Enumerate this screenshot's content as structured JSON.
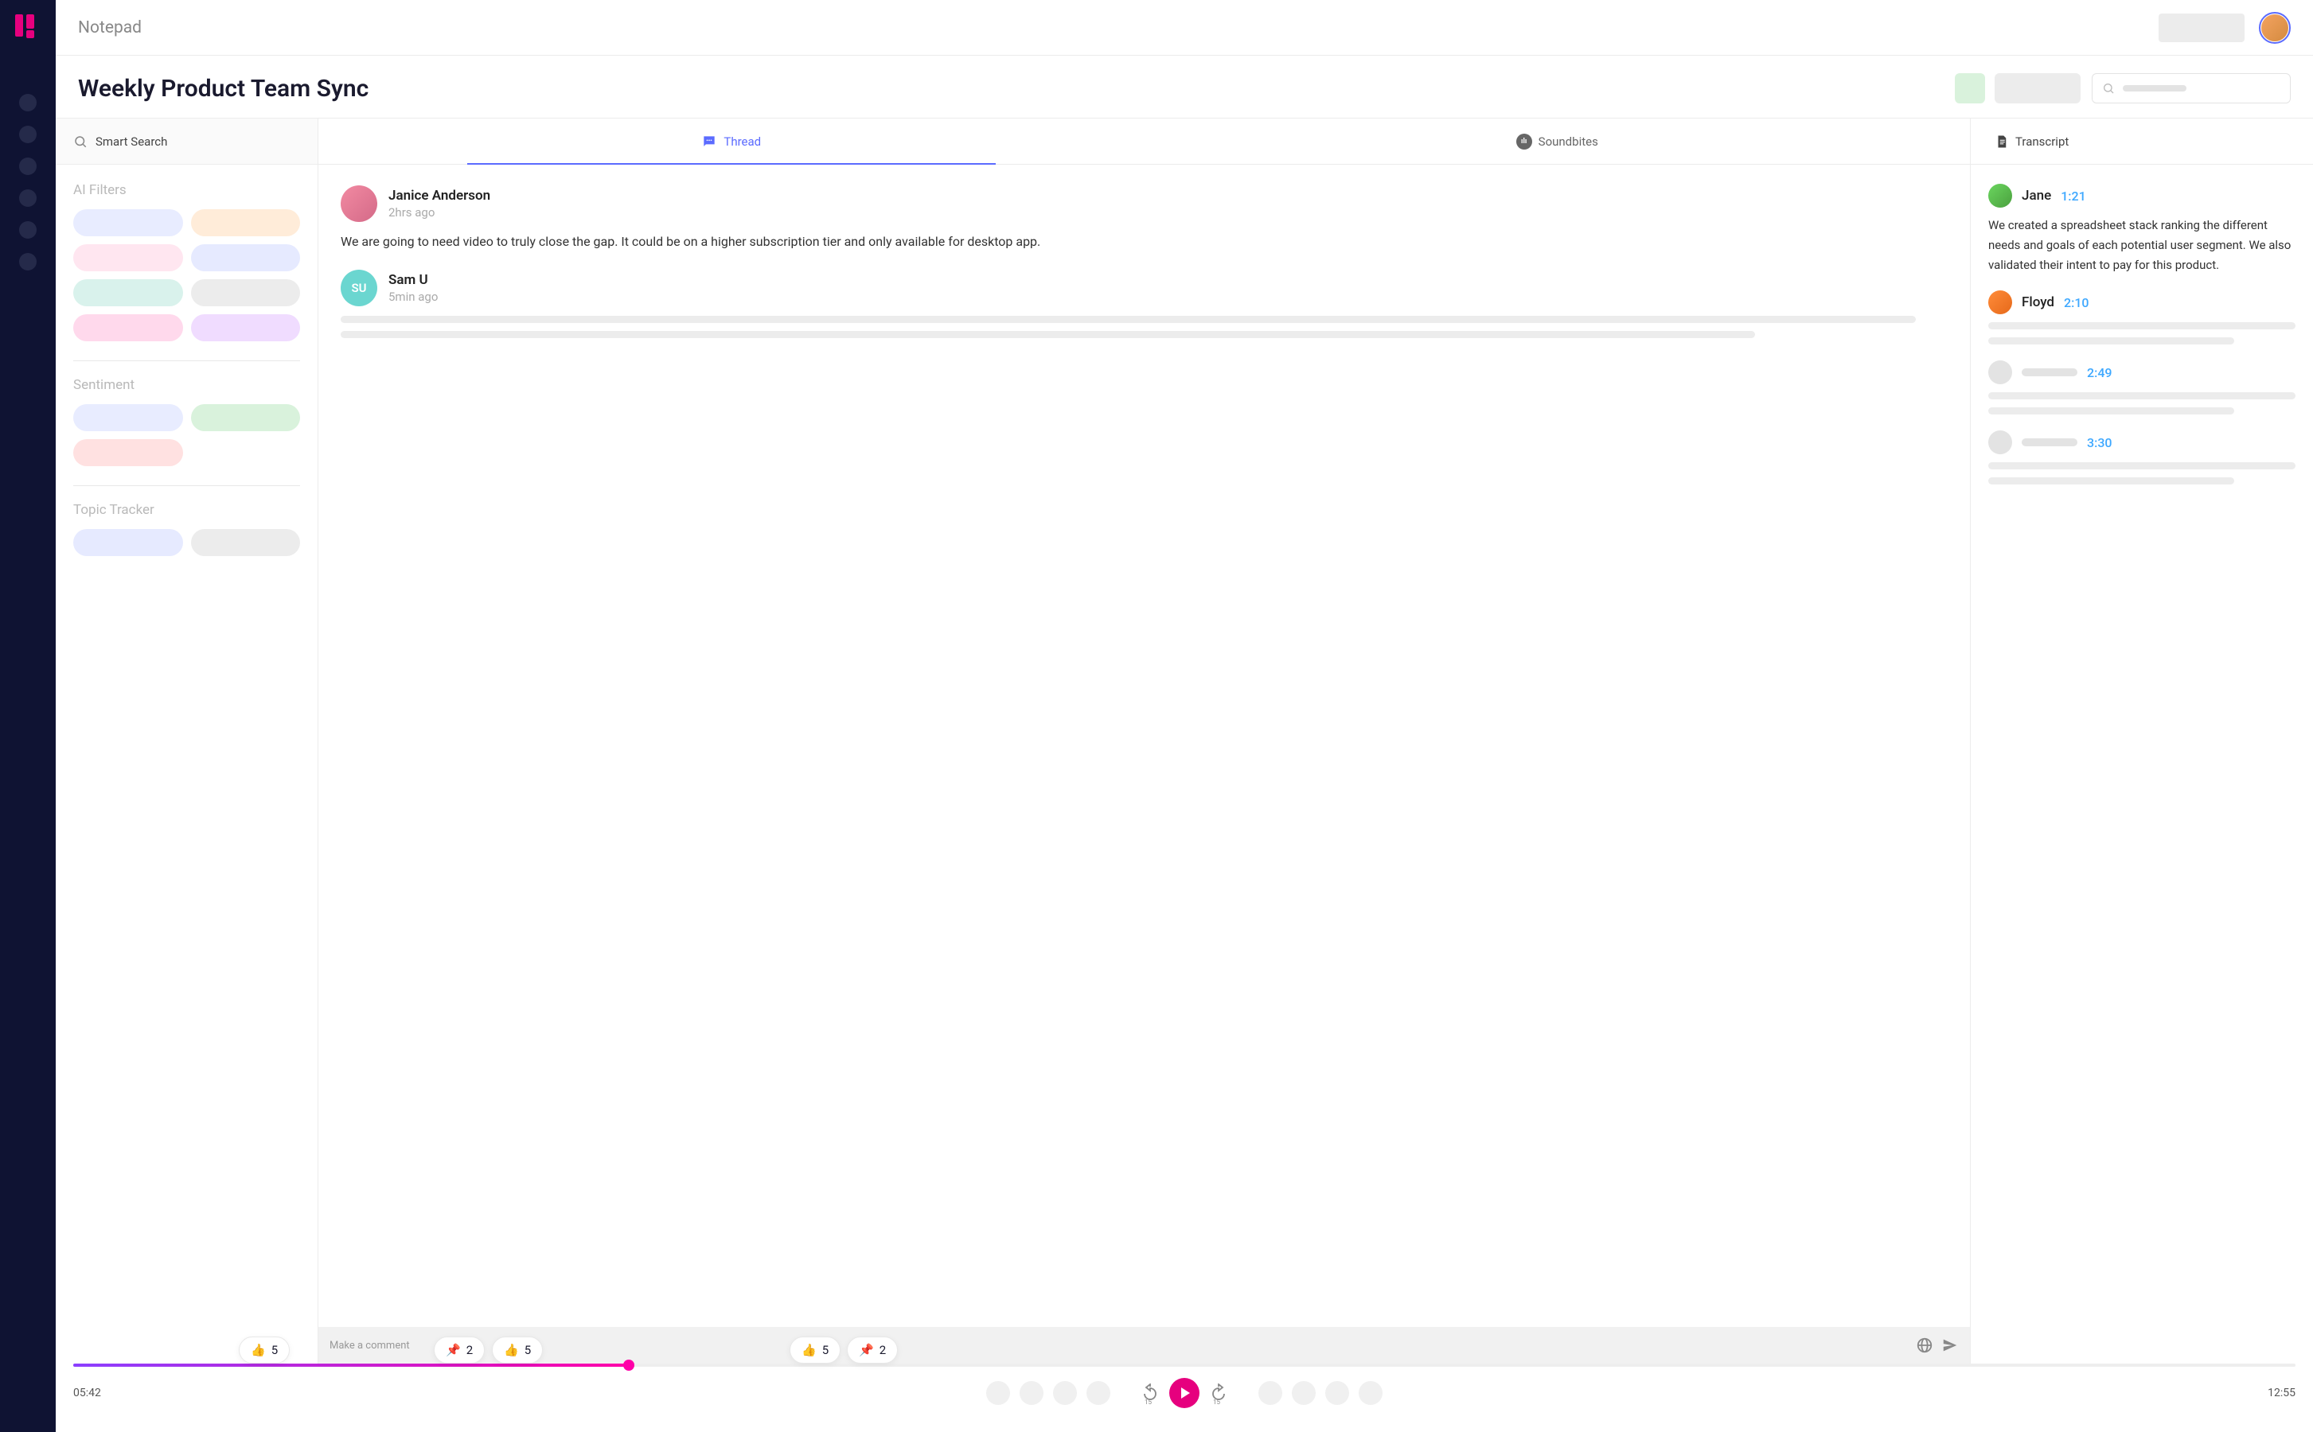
{
  "app": {
    "section": "Notepad"
  },
  "page": {
    "title": "Weekly Product Team Sync"
  },
  "leftPanel": {
    "smartSearch": "Smart Search",
    "sections": {
      "aiFilters": "AI Filters",
      "sentiment": "Sentiment",
      "topicTracker": "Topic Tracker"
    },
    "filterColors": {
      "aiFilters": [
        "#e8ecff",
        "#ffecd9",
        "#ffe6f0",
        "#e6eaff",
        "#d9f2ec",
        "#ececec",
        "#ffd9ec",
        "#f0dcff"
      ],
      "sentiment": [
        "#e8ecff",
        "#d9f2dc",
        "#ffe1e1"
      ],
      "topicTracker": [
        "#e6eaff",
        "#ececec"
      ]
    }
  },
  "centerPanel": {
    "tabs": {
      "thread": "Thread",
      "soundbites": "Soundbites"
    },
    "activeTab": "thread",
    "posts": [
      {
        "author": "Janice Anderson",
        "meta": "2hrs ago",
        "avatarBg": "linear-gradient(135deg,#f28aa2,#d46a88)",
        "text": "We are going to need video to truly close the gap. It could be on a higher subscription tier and only available for desktop app."
      },
      {
        "author": "Sam U",
        "meta": "5min ago",
        "initials": "SU",
        "skeleton": true
      }
    ],
    "commentPlaceholder": "Make a comment"
  },
  "rightPanel": {
    "tab": "Transcript",
    "entries": [
      {
        "speaker": "Jane",
        "time": "1:21",
        "avatarBg": "linear-gradient(135deg,#6bd65f,#4aa03e)",
        "text": "We created a spreadsheet stack ranking the different needs and goals of each potential user segment. We also validated their intent to pay for this product."
      },
      {
        "speaker": "Floyd",
        "time": "2:10",
        "avatarBg": "linear-gradient(135deg,#ff8c3a,#e6691a)",
        "skeleton": true
      },
      {
        "time": "2:49",
        "skeleton": true,
        "anon": true
      },
      {
        "time": "3:30",
        "skeleton": true,
        "anon": true
      }
    ]
  },
  "reactions": {
    "r1": {
      "icon": "thumb",
      "count": "5"
    },
    "r2": {
      "icon": "pin",
      "count": "2"
    },
    "r3": {
      "icon": "thumb",
      "count": "5"
    },
    "r4": {
      "icon": "thumb",
      "count": "5"
    },
    "r5": {
      "icon": "pin",
      "count": "2"
    }
  },
  "player": {
    "current": "05:42",
    "duration": "12:55",
    "skipBack": "15",
    "skipFwd": "15"
  }
}
